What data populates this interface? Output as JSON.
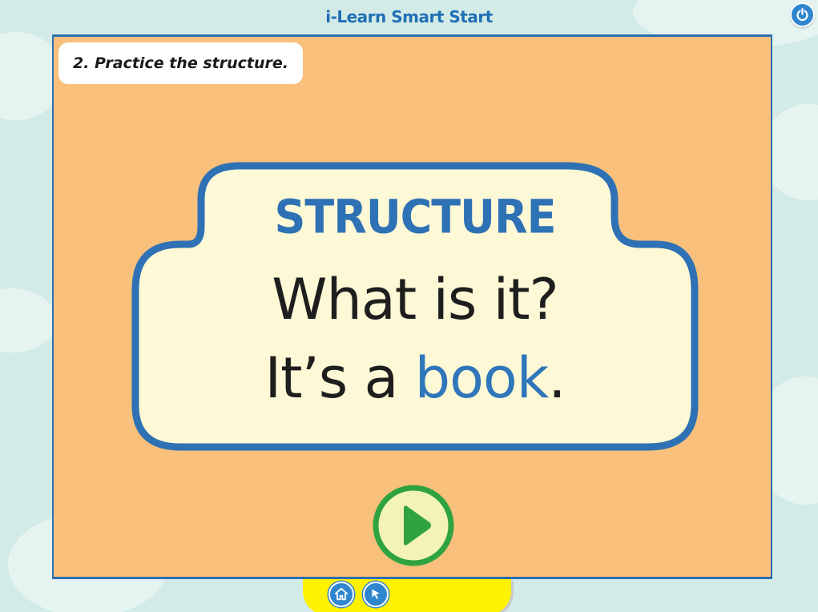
{
  "app": {
    "title": "i-Learn Smart Start"
  },
  "toolbar": {
    "power_icon": "power-icon",
    "home_icon": "home-icon",
    "cursor_icon": "cursor-arrow-icon"
  },
  "activity": {
    "instruction": "2. Practice the structure.",
    "card_title": "STRUCTURE",
    "question": "What is it?",
    "answer_prefix": "It’s a ",
    "answer_keyword": "book",
    "answer_suffix": ".",
    "play_icon": "play-icon"
  },
  "colors": {
    "stage_bg": "#f8c07b",
    "card_bg": "#fdf8d6",
    "card_border": "#2e71b4",
    "keyword": "#2f76ba",
    "play_green": "#2fa33f",
    "bar_yellow": "#fff200"
  }
}
